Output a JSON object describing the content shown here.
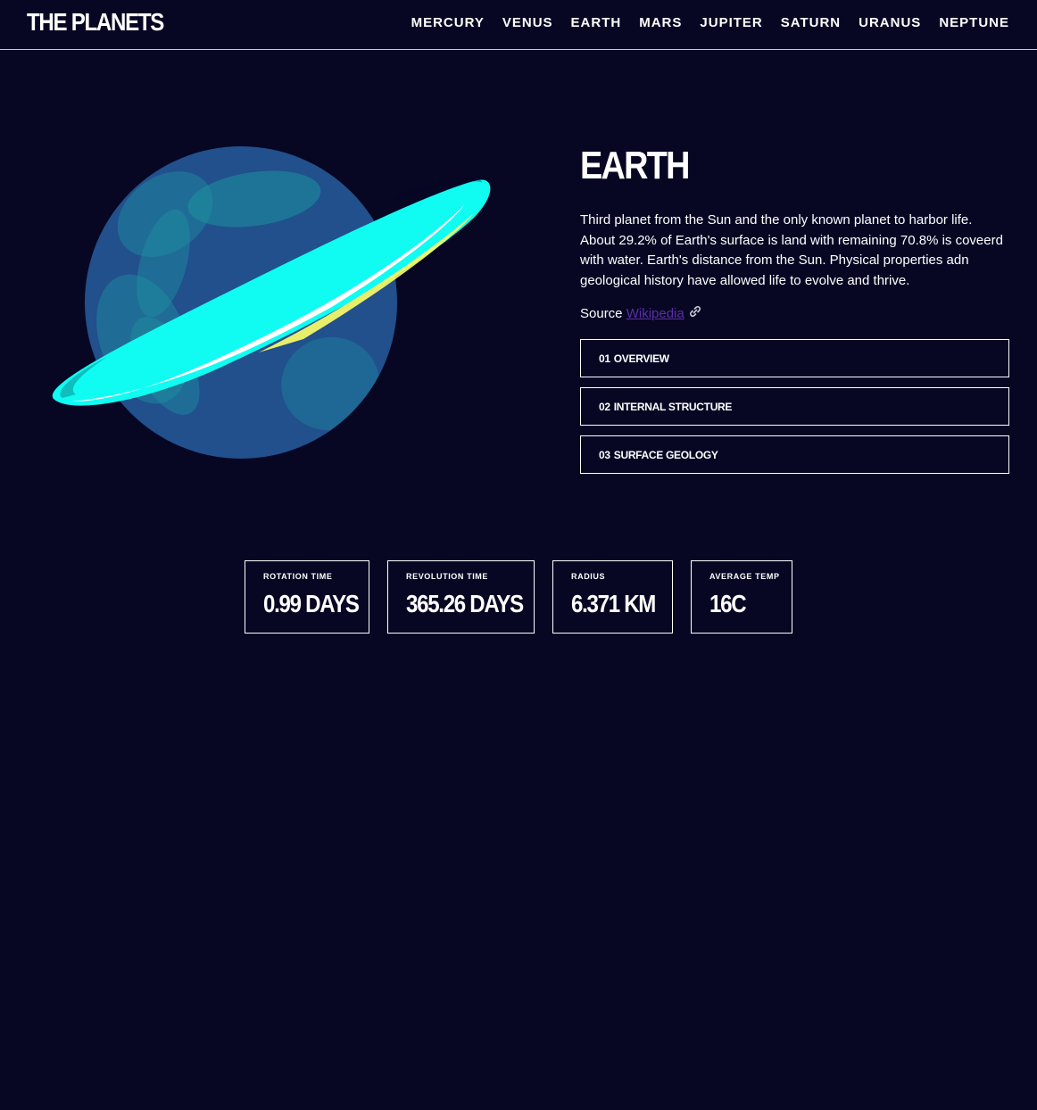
{
  "header": {
    "logo": "THE PLANETS",
    "nav": [
      "MERCURY",
      "VENUS",
      "EARTH",
      "MARS",
      "JUPITER",
      "SATURN",
      "URANUS",
      "NEPTUNE"
    ]
  },
  "planet": {
    "name": "EARTH",
    "description": "Third planet from the Sun and the only known planet to harbor life. About 29.2% of Earth's surface is land with remaining 70.8% is coveerd with water. Earth's distance from the Sun. Physical properties adn geological history have allowed life to evolve and thrive.",
    "source_label": "Source",
    "source_link": "Wikipedia",
    "image_icon": "planet-with-ring-illustration"
  },
  "tabs": [
    {
      "num": "01",
      "label": "OVERVIEW"
    },
    {
      "num": "02",
      "label": "INTERNAL STRUCTURE"
    },
    {
      "num": "03",
      "label": "SURFACE GEOLOGY"
    }
  ],
  "stats": [
    {
      "label": "ROTATION TIME",
      "value": "0.99 DAYS"
    },
    {
      "label": "REVOLUTION TIME",
      "value": "365.26 DAYS"
    },
    {
      "label": "RADIUS",
      "value": "6.371 KM"
    },
    {
      "label": "AVERAGE TEMP",
      "value": "16C"
    }
  ],
  "colors": {
    "background": "#070724",
    "planet_body": "#235592",
    "continents": "#1f9aa8",
    "ring": "#10fcf2",
    "ring_highlight": "#ffff66",
    "link": "#5b2fa8"
  }
}
